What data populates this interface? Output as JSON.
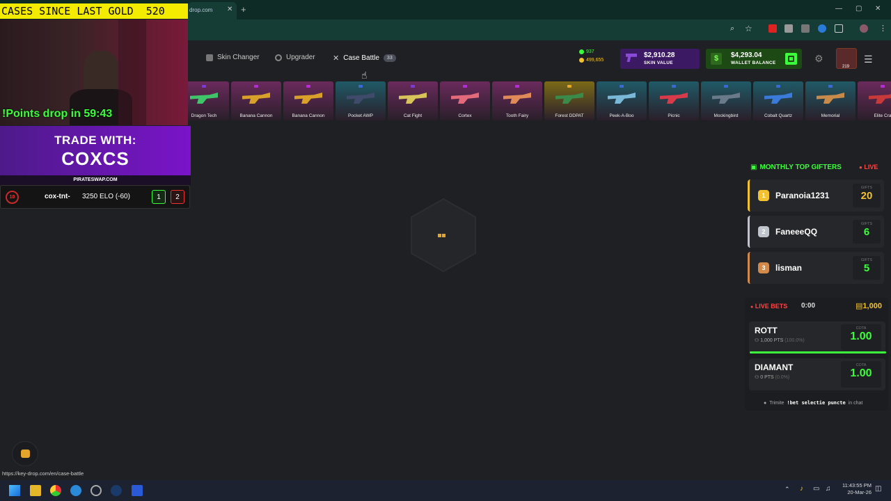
{
  "browser": {
    "tab_title": "drop.com",
    "new_tab_label": "+",
    "status_url": "https://key-drop.com/en/case-battle"
  },
  "nav": {
    "skin_changer": "Skin Changer",
    "upgrader": "Upgrader",
    "case_battle": "Case Battle",
    "case_battle_count": "33"
  },
  "header": {
    "online_count": "937",
    "gold_count": "499,655",
    "skin_value": "$2,910.28",
    "skin_value_label": "SKIN VALUE",
    "wallet_balance": "$4,293.04",
    "wallet_label": "WALLET BALANCE",
    "avatar_level": "219"
  },
  "skins": [
    {
      "name": "Dragon Tech",
      "bg": "#6a2a5c",
      "pin": "#7a3ad6",
      "gun": "#3fc46a"
    },
    {
      "name": "Banana Cannon",
      "bg": "#6a2a5c",
      "pin": "#b52dd6",
      "gun": "#d9a02a"
    },
    {
      "name": "Banana Cannon",
      "bg": "#6a2a5c",
      "pin": "#b52dd6",
      "gun": "#d9a02a"
    },
    {
      "name": "Pocket AWP",
      "bg": "#1f5a66",
      "pin": "#3a6ad6",
      "gun": "#404a6a"
    },
    {
      "name": "Cat Fight",
      "bg": "#6a2a5c",
      "pin": "#7a3ad6",
      "gun": "#d7c35a"
    },
    {
      "name": "Cortex",
      "bg": "#6a2a5c",
      "pin": "#b52dd6",
      "gun": "#e26a7a"
    },
    {
      "name": "Tooth Fairy",
      "bg": "#6a2a5c",
      "pin": "#b52dd6",
      "gun": "#e08a5a"
    },
    {
      "name": "Forest DDPAT",
      "bg": "#7a6a18",
      "pin": "#e6a82a",
      "gun": "#3a8a4a"
    },
    {
      "name": "Peek-A-Boo",
      "bg": "#1f5a66",
      "pin": "#3a6ad6",
      "gun": "#7ab8d8"
    },
    {
      "name": "Picnic",
      "bg": "#1f5a66",
      "pin": "#3a6ad6",
      "gun": "#d83a4a"
    },
    {
      "name": "Mockingbird",
      "bg": "#1f5a66",
      "pin": "#3a6ad6",
      "gun": "#6a7a8a"
    },
    {
      "name": "Cobalt Quartz",
      "bg": "#1f5a66",
      "pin": "#3a6ad6",
      "gun": "#3a7ad8"
    },
    {
      "name": "Memorial",
      "bg": "#1f5a66",
      "pin": "#3a6ad6",
      "gun": "#c88a4a"
    },
    {
      "name": "Elite Cra",
      "bg": "#6a2a5c",
      "pin": "#b52dd6",
      "gun": "#c83a3a"
    }
  ],
  "stream_overlay": {
    "gold_banner": "CASES SINCE LAST GOLD  520",
    "points_drop": "!Points drop in 59:43",
    "trade_line1": "TRADE WITH:",
    "trade_line2": "COXCS",
    "sponsor": "PIRATESWAP.COM",
    "faceit_level": "10",
    "faceit_name": "cox-tnt-",
    "faceit_elo": "3250 ELO (-60)",
    "score_win": "1",
    "score_loss": "2"
  },
  "gifters": {
    "title": "MONTHLY TOP GIFTERS",
    "live_label": "LIVE",
    "gifts_label": "GIFTS",
    "items": [
      {
        "rank": "1",
        "name": "Paranoia1231",
        "gifts": "20",
        "color": "#f2c230"
      },
      {
        "rank": "2",
        "name": "FaneeeQQ",
        "gifts": "6",
        "color": "#c0c4cc"
      },
      {
        "rank": "3",
        "name": "lisman",
        "gifts": "5",
        "color": "#d28a4a"
      }
    ]
  },
  "live_bets": {
    "title": "LIVE BETS",
    "timer": "0:00",
    "pot": "1,000",
    "cota_label": "COTA",
    "items": [
      {
        "name": "ROTT",
        "stats": "1,000 PTS",
        "pct": "(100.0%)",
        "cota": "1.00"
      },
      {
        "name": "DIAMANT",
        "stats": "0 PTS",
        "pct": "(0.0%)",
        "cota": "1.00"
      }
    ],
    "footer_prefix": "Trimite",
    "footer_cmd": "!bet selectie puncte",
    "footer_suffix": "in chat"
  },
  "taskbar": {
    "time": "11:43:55 PM",
    "date": "20-Mar-26"
  },
  "colors": {
    "accent_green": "#3cff3c",
    "gold": "#f2c230",
    "live_red": "#ff4444"
  }
}
